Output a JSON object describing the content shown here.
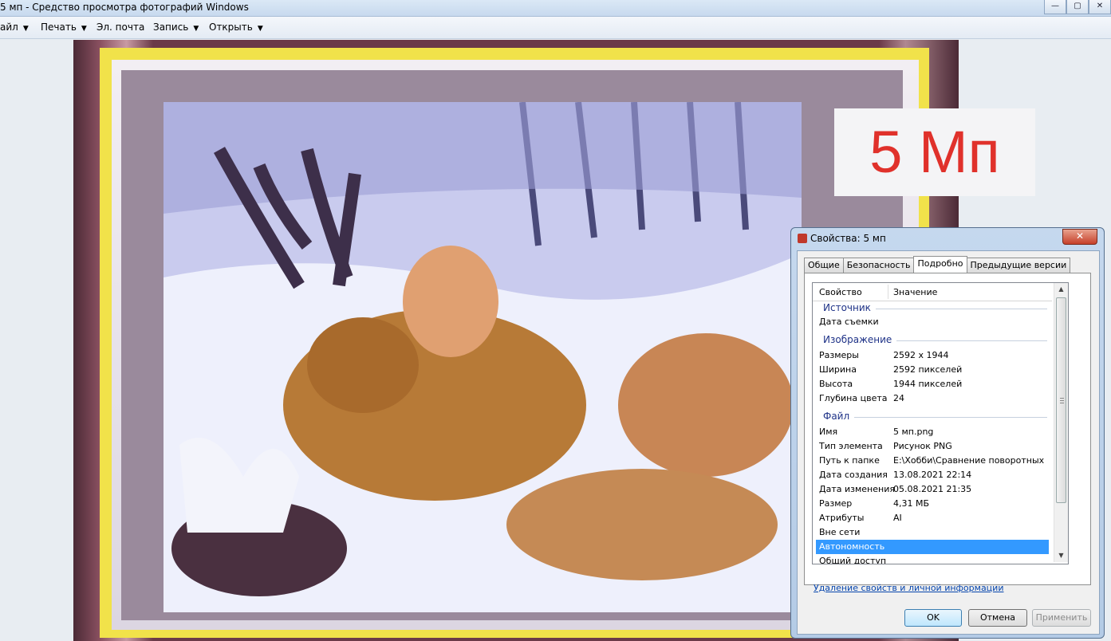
{
  "window": {
    "title": "5 мп - Средство просмотра фотографий Windows",
    "controls": {
      "minimize": "—",
      "maximize": "▢",
      "close": "✕"
    }
  },
  "menu": [
    {
      "label": "айл"
    },
    {
      "label": "Печать"
    },
    {
      "label": "Эл. почта"
    },
    {
      "label": "Запись"
    },
    {
      "label": "Открыть"
    }
  ],
  "overlay": {
    "label": "5 Мп",
    "color": "#e0312b"
  },
  "dialog": {
    "title": "Свойства: 5 мп",
    "close_glyph": "✕",
    "tabs": [
      "Общие",
      "Безопасность",
      "Подробно",
      "Предыдущие версии"
    ],
    "active_tab": "Подробно",
    "columns": {
      "property": "Свойство",
      "value": "Значение"
    },
    "groups": {
      "source": "Источник",
      "image": "Изображение",
      "file": "Файл"
    },
    "rows": {
      "date_taken": {
        "k": "Дата съемки",
        "v": ""
      },
      "dimensions": {
        "k": "Размеры",
        "v": "2592 x 1944"
      },
      "width": {
        "k": "Ширина",
        "v": "2592 пикселей"
      },
      "height": {
        "k": "Высота",
        "v": "1944 пикселей"
      },
      "bit_depth": {
        "k": "Глубина цвета",
        "v": "24"
      },
      "name": {
        "k": "Имя",
        "v": "5 мп.png"
      },
      "item_type": {
        "k": "Тип элемента",
        "v": "Рисунок PNG"
      },
      "folder_path": {
        "k": "Путь к папке",
        "v": "E:\\Хобби\\Сравнение поворотных"
      },
      "created": {
        "k": "Дата создания",
        "v": "13.08.2021 22:14"
      },
      "modified": {
        "k": "Дата изменения",
        "v": "05.08.2021 21:35"
      },
      "size": {
        "k": "Размер",
        "v": "4,31 МБ"
      },
      "attributes": {
        "k": "Атрибуты",
        "v": "AI"
      },
      "offline": {
        "k": "Вне сети",
        "v": ""
      },
      "availability": {
        "k": "Автономность",
        "v": ""
      },
      "sharing": {
        "k": "Общий доступ",
        "v": ""
      }
    },
    "remove_link": "Удаление свойств и личной информации",
    "buttons": {
      "ok": "OK",
      "cancel": "Отмена",
      "apply": "Применить"
    }
  }
}
